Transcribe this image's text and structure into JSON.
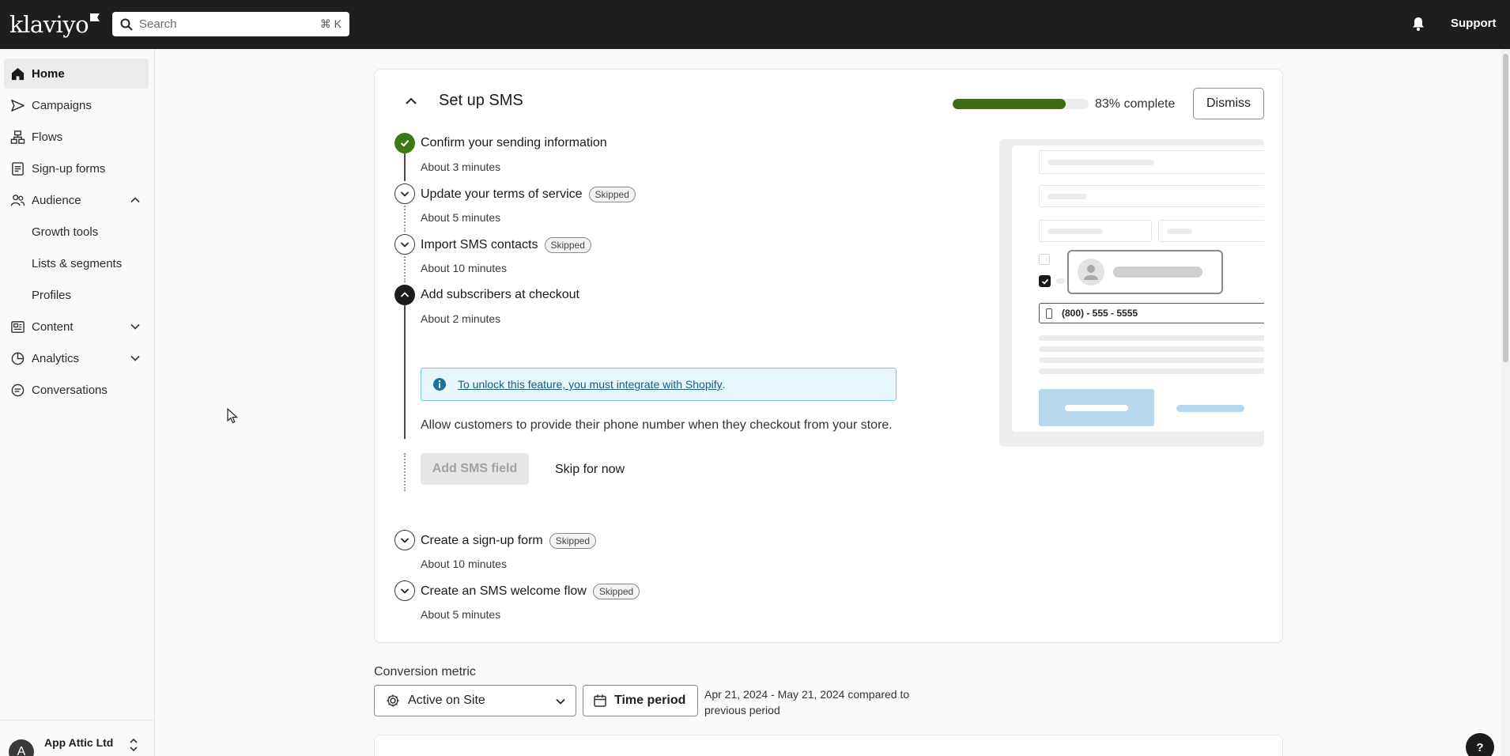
{
  "topbar": {
    "logo": "klaviyo",
    "search_placeholder": "Search",
    "search_shortcut": "⌘ K",
    "support_label": "Support"
  },
  "sidebar": {
    "items": [
      {
        "label": "Home",
        "icon": "home-icon",
        "active": true
      },
      {
        "label": "Campaigns",
        "icon": "send-icon"
      },
      {
        "label": "Flows",
        "icon": "flows-icon"
      },
      {
        "label": "Sign-up forms",
        "icon": "form-icon"
      },
      {
        "label": "Audience",
        "icon": "audience-icon",
        "expanded": true
      },
      {
        "label": "Content",
        "icon": "content-icon"
      },
      {
        "label": "Analytics",
        "icon": "analytics-icon"
      },
      {
        "label": "Conversations",
        "icon": "chat-icon"
      }
    ],
    "audience_sub": [
      "Growth tools",
      "Lists & segments",
      "Profiles"
    ],
    "account": {
      "avatar_letter": "A",
      "name": "App Attic Ltd"
    }
  },
  "setup": {
    "title": "Set up SMS",
    "progress": 0.83,
    "progress_text": "83% complete",
    "dismiss_label": "Dismiss",
    "steps": [
      {
        "title": "Confirm your sending information",
        "time": "About 3 minutes",
        "status": "done"
      },
      {
        "title": "Update your terms of service",
        "time": "About 5 minutes",
        "badge": "Skipped"
      },
      {
        "title": "Import SMS contacts",
        "time": "About 10 minutes",
        "badge": "Skipped"
      },
      {
        "title": "Add subscribers at checkout",
        "time": "About 2 minutes",
        "status": "open"
      },
      {
        "title": "Create a sign-up form",
        "time": "About 10 minutes",
        "badge": "Skipped"
      },
      {
        "title": "Create an SMS welcome flow",
        "time": "About 5 minutes",
        "badge": "Skipped"
      }
    ],
    "active_step": {
      "info_link": "To unlock this feature, you must integrate with Shopify",
      "info_suffix": ".",
      "description": "Allow customers to provide their phone number when they checkout from your store.",
      "primary_button": "Add SMS field",
      "secondary_link": "Skip for now"
    },
    "illustration": {
      "phone_placeholder": "(800) - 555 - 5555"
    }
  },
  "conversion": {
    "label": "Conversion metric",
    "metric_value": "Active on Site",
    "time_period_label": "Time period",
    "date_range": "Apr 21, 2024 - May 21, 2024 compared to previous period"
  },
  "help_label": "?",
  "colors": {
    "topbar": "#1e1e1e",
    "progress": "#3f6b12",
    "done": "#3c7a16",
    "info_bg": "#e6f6fc"
  }
}
